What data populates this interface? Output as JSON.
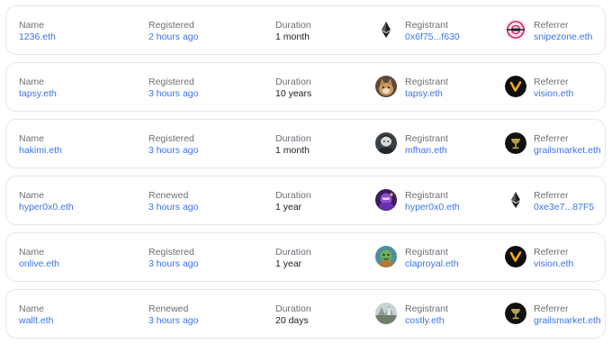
{
  "labels": {
    "name": "Name",
    "duration": "Duration",
    "registrant": "Registrant",
    "referrer": "Referrer"
  },
  "rows": [
    {
      "name": "1236.eth",
      "action": "Registered",
      "time": "2 hours ago",
      "duration": "1 month",
      "registrant": "0x6f75...f630",
      "registrant_icon": "ethereum-icon",
      "referrer": "snipezone.eth",
      "referrer_icon": "snipezone-crosshair-avatar"
    },
    {
      "name": "tapsy.eth",
      "action": "Registered",
      "time": "3 hours ago",
      "duration": "10 years",
      "registrant": "tapsy.eth",
      "registrant_icon": "cat-avatar",
      "referrer": "vision.eth",
      "referrer_icon": "vision-logo-avatar"
    },
    {
      "name": "hakimi.eth",
      "action": "Registered",
      "time": "3 hours ago",
      "duration": "1 month",
      "registrant": "mfhan.eth",
      "registrant_icon": "portrait-avatar",
      "referrer": "grailsmarket.eth",
      "referrer_icon": "grail-chalice-avatar"
    },
    {
      "name": "hyper0x0.eth",
      "action": "Renewed",
      "time": "3 hours ago",
      "duration": "1 year",
      "registrant": "hyper0x0.eth",
      "registrant_icon": "purple-character-avatar",
      "referrer": "0xe3e7...87F5",
      "referrer_icon": "ethereum-icon"
    },
    {
      "name": "onlive.eth",
      "action": "Registered",
      "time": "3 hours ago",
      "duration": "1 year",
      "registrant": "claproyal.eth",
      "registrant_icon": "green-character-avatar",
      "referrer": "vision.eth",
      "referrer_icon": "vision-logo-avatar"
    },
    {
      "name": "wallt.eth",
      "action": "Renewed",
      "time": "3 hours ago",
      "duration": "20 days",
      "registrant": "costly.eth",
      "registrant_icon": "landscape-avatar",
      "referrer": "grailsmarket.eth",
      "referrer_icon": "grail-chalice-avatar"
    }
  ],
  "colors": {
    "link": "#3a74e8",
    "label": "#6b6f76",
    "value": "#1c1d20",
    "card_border": "#e6e7eb"
  }
}
